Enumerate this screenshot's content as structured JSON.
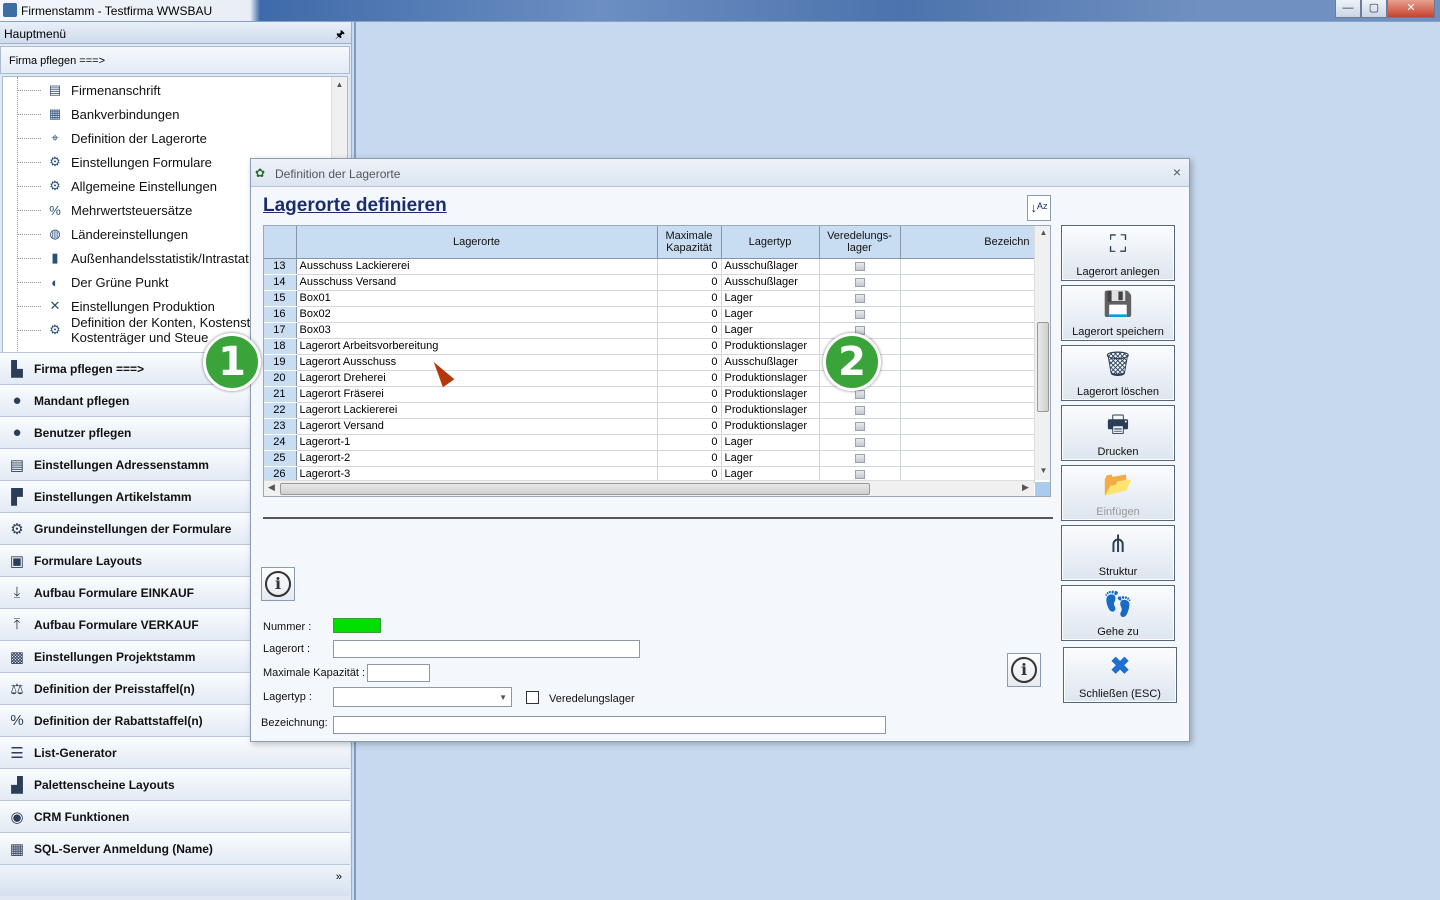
{
  "window": {
    "title": "Firmenstamm - Testfirma WWSBAU",
    "minimize": "—",
    "maximize": "▢",
    "close": "✕"
  },
  "left_panel": {
    "header": "Hauptmenü",
    "pin": "🖈",
    "subheader": "Firma pflegen    ===>",
    "tree_items": [
      {
        "label": "Firmenanschrift",
        "icon": "address-card-icon",
        "glyph": "▤"
      },
      {
        "label": "Bankverbindungen",
        "icon": "bank-card-icon",
        "glyph": "▦"
      },
      {
        "label": "Definition der Lagerorte",
        "icon": "map-pin-icon",
        "glyph": "⌖"
      },
      {
        "label": "Einstellungen Formulare",
        "icon": "form-settings-icon",
        "glyph": "⚙"
      },
      {
        "label": "Allgemeine Einstellungen",
        "icon": "gears-icon",
        "glyph": "⚙"
      },
      {
        "label": "Mehrwertsteuersätze",
        "icon": "percent-icon",
        "glyph": "%"
      },
      {
        "label": "Ländereinstellungen",
        "icon": "globe-icon",
        "glyph": "◍"
      },
      {
        "label": "Außenhandelsstatistik/Intrastat",
        "icon": "bar-chart-icon",
        "glyph": "▮"
      },
      {
        "label": "Der Grüne Punkt",
        "icon": "green-dot-icon",
        "glyph": "◐"
      },
      {
        "label": "Einstellungen Produktion",
        "icon": "tools-icon",
        "glyph": "✕"
      },
      {
        "label": "Definition der Konten, Kostenst",
        "label2": "Kostenträger und Steue",
        "icon": "accounts-icon",
        "glyph": "⚙"
      }
    ],
    "menu_items": [
      {
        "label": "Firma pflegen    ===>",
        "icon": "factory-icon",
        "glyph": "▙"
      },
      {
        "label": "Mandant pflegen",
        "icon": "client-icon",
        "glyph": "●"
      },
      {
        "label": "Benutzer pflegen",
        "icon": "users-icon",
        "glyph": "●"
      },
      {
        "label": "Einstellungen Adressenstamm",
        "icon": "address-icon",
        "glyph": "▤"
      },
      {
        "label": "Einstellungen Artikelstamm",
        "icon": "article-icon",
        "glyph": "▛"
      },
      {
        "label": "Grundeinstellungen der Formulare",
        "icon": "form-settings-icon",
        "glyph": "⚙"
      },
      {
        "label": "Formulare Layouts",
        "icon": "layout-icon",
        "glyph": "▣"
      },
      {
        "label": "Aufbau Formulare EINKAUF",
        "icon": "download-icon",
        "glyph": "⤓"
      },
      {
        "label": "Aufbau Formulare VERKAUF",
        "icon": "upload-icon",
        "glyph": "⤒"
      },
      {
        "label": "Einstellungen Projektstamm",
        "icon": "project-icon",
        "glyph": "▩"
      },
      {
        "label": "Definition der Preisstaffel(n)",
        "icon": "price-icon",
        "glyph": "⚖"
      },
      {
        "label": "Definition der Rabattstaffel(n)",
        "icon": "discount-icon",
        "glyph": "%"
      },
      {
        "label": "List-Generator",
        "icon": "list-icon",
        "glyph": "☰"
      },
      {
        "label": "Palettenscheine Layouts",
        "icon": "pallet-icon",
        "glyph": "▟"
      },
      {
        "label": "CRM Funktionen",
        "icon": "crm-icon",
        "glyph": "◉"
      },
      {
        "label": "SQL-Server Anmeldung (Name)",
        "icon": "server-icon",
        "glyph": "▦"
      }
    ],
    "footer_more": "»"
  },
  "badges": [
    "1",
    "2"
  ],
  "dialog": {
    "title": "Definition der Lagerorte",
    "close": "×",
    "heading": "Lagerorte definieren",
    "sort_icon_label": "↓ᴬᶻ",
    "columns": [
      "",
      "Lagerorte",
      "Maximale Kapazität",
      "Lagertyp",
      "Veredelungs-lager",
      "Bezeichn"
    ],
    "rows": [
      {
        "nr": "13",
        "name": "Ausschuss Lackiererei",
        "kap": "0",
        "typ": "Ausschußlager"
      },
      {
        "nr": "14",
        "name": "Ausschuss Versand",
        "kap": "0",
        "typ": "Ausschußlager"
      },
      {
        "nr": "15",
        "name": "Box01",
        "kap": "0",
        "typ": "Lager"
      },
      {
        "nr": "16",
        "name": "Box02",
        "kap": "0",
        "typ": "Lager"
      },
      {
        "nr": "17",
        "name": "Box03",
        "kap": "0",
        "typ": "Lager"
      },
      {
        "nr": "18",
        "name": "Lagerort Arbeitsvorbereitung",
        "kap": "0",
        "typ": "Produktionslager"
      },
      {
        "nr": "19",
        "name": "Lagerort Ausschuss",
        "kap": "0",
        "typ": "Ausschußlager"
      },
      {
        "nr": "20",
        "name": "Lagerort Dreherei",
        "kap": "0",
        "typ": "Produktionslager"
      },
      {
        "nr": "21",
        "name": "Lagerort Fräserei",
        "kap": "0",
        "typ": "Produktionslager"
      },
      {
        "nr": "22",
        "name": "Lagerort Lackiererei",
        "kap": "0",
        "typ": "Produktionslager"
      },
      {
        "nr": "23",
        "name": "Lagerort Versand",
        "kap": "0",
        "typ": "Produktionslager"
      },
      {
        "nr": "24",
        "name": "Lagerort-1",
        "kap": "0",
        "typ": "Lager"
      },
      {
        "nr": "25",
        "name": "Lagerort-2",
        "kap": "0",
        "typ": "Lager"
      },
      {
        "nr": "26",
        "name": "Lagerort-3",
        "kap": "0",
        "typ": "Lager"
      }
    ],
    "form": {
      "nummer_label": "Nummer :",
      "lagerort_label": "Lagerort :",
      "kapazitaet_label": "Maximale Kapazität :",
      "lagertyp_label": "Lagertyp :",
      "veredelung_label": "Veredelungslager",
      "bezeichnung_label": "Bezeichnung:"
    },
    "buttons": [
      {
        "label": "Lagerort anlegen",
        "icon": "map-add-icon",
        "glyph": "⛶"
      },
      {
        "label": "Lagerort speichern",
        "icon": "save-icon",
        "glyph": "💾"
      },
      {
        "label": "Lagerort löschen",
        "icon": "trash-icon",
        "glyph": "🗑"
      },
      {
        "label": "Drucken",
        "icon": "printer-icon",
        "glyph": "🖶"
      },
      {
        "label": "Einfügen",
        "icon": "paste-folder-icon",
        "glyph": "📂"
      },
      {
        "label": "Struktur",
        "icon": "structure-icon",
        "glyph": "⋔"
      },
      {
        "label": "Gehe zu",
        "icon": "footprints-icon",
        "glyph": "👣"
      },
      {
        "label": "Schließen (ESC)",
        "icon": "close-x-icon",
        "glyph": "✖"
      }
    ],
    "colors": {
      "number_field": "#00e000",
      "header_bg": "#c9ddf2",
      "heading": "#1a2e6b"
    }
  }
}
